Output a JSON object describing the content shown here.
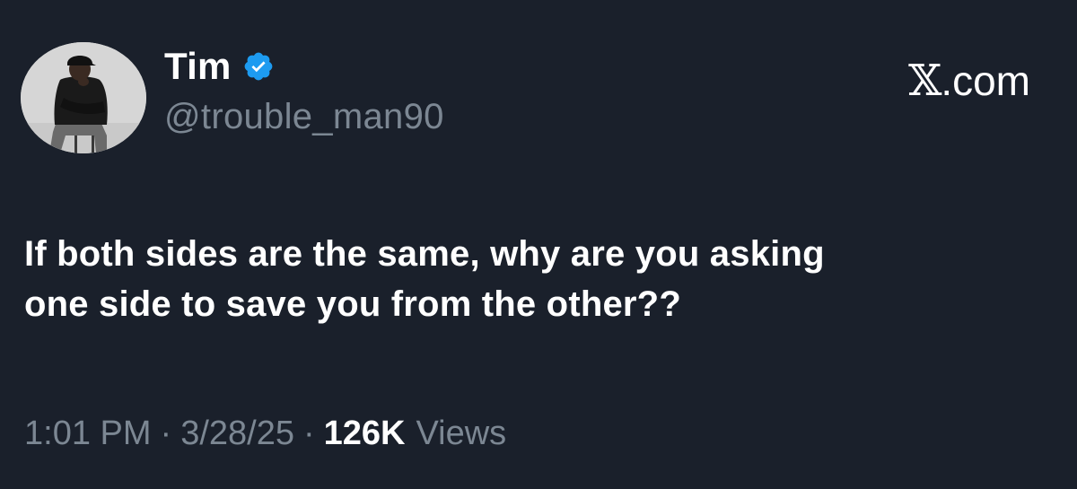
{
  "author": {
    "display_name": "Tim",
    "handle": "@trouble_man90",
    "avatar": "avatar-photo",
    "verified_icon": "verified-badge-icon"
  },
  "brand": {
    "label": ".com",
    "logo": "x-logo-icon"
  },
  "tweet": {
    "line1": "If both sides are the same, why are you asking",
    "line2": "one side to save you from the other??"
  },
  "meta": {
    "time": "1:01 PM",
    "date": "3/28/25",
    "separator": "·",
    "views_count": "126K",
    "views_label": "Views"
  },
  "colors": {
    "background": "#1a202b",
    "primary_text": "#ffffff",
    "secondary_text": "#7c8793",
    "verified_blue": "#1d9bf0"
  }
}
